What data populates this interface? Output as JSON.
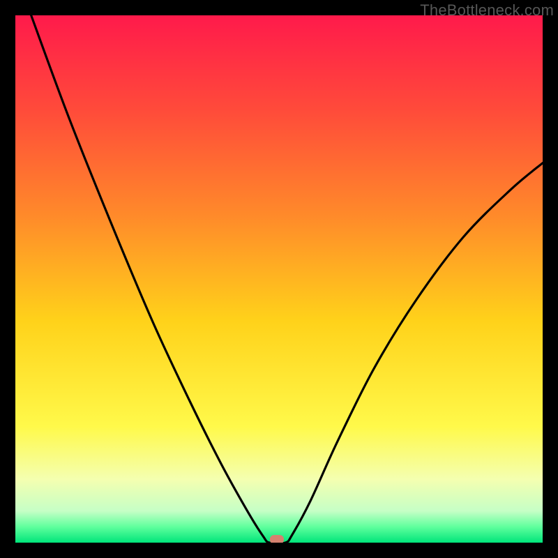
{
  "watermark": "TheBottleneck.com",
  "chart_data": {
    "type": "line",
    "title": "",
    "xlabel": "",
    "ylabel": "",
    "xlim": [
      0,
      100
    ],
    "ylim": [
      0,
      100
    ],
    "background_gradient_stops": [
      {
        "pct": 0.0,
        "color": "#ff1a4b"
      },
      {
        "pct": 18.0,
        "color": "#ff4b3a"
      },
      {
        "pct": 38.0,
        "color": "#ff8a2a"
      },
      {
        "pct": 58.0,
        "color": "#ffd21a"
      },
      {
        "pct": 78.0,
        "color": "#fff94a"
      },
      {
        "pct": 88.0,
        "color": "#f4ffb0"
      },
      {
        "pct": 94.0,
        "color": "#c6ffc6"
      },
      {
        "pct": 97.0,
        "color": "#5fff9d"
      },
      {
        "pct": 100.0,
        "color": "#00e57a"
      }
    ],
    "series": [
      {
        "name": "bottleneck-curve",
        "points": [
          {
            "x": 3.0,
            "y": 100.0
          },
          {
            "x": 10.0,
            "y": 81.0
          },
          {
            "x": 18.0,
            "y": 61.0
          },
          {
            "x": 26.0,
            "y": 42.0
          },
          {
            "x": 33.0,
            "y": 27.0
          },
          {
            "x": 39.0,
            "y": 15.0
          },
          {
            "x": 44.0,
            "y": 6.0
          },
          {
            "x": 47.0,
            "y": 1.2
          },
          {
            "x": 48.2,
            "y": 0.0
          },
          {
            "x": 51.2,
            "y": 0.0
          },
          {
            "x": 52.5,
            "y": 1.5
          },
          {
            "x": 56.0,
            "y": 8.0
          },
          {
            "x": 61.0,
            "y": 19.0
          },
          {
            "x": 68.0,
            "y": 33.0
          },
          {
            "x": 76.0,
            "y": 46.0
          },
          {
            "x": 85.0,
            "y": 58.0
          },
          {
            "x": 94.0,
            "y": 67.0
          },
          {
            "x": 100.0,
            "y": 72.0
          }
        ]
      }
    ],
    "marker": {
      "x": 49.6,
      "y": 0.6,
      "color": "#d5816f"
    }
  }
}
